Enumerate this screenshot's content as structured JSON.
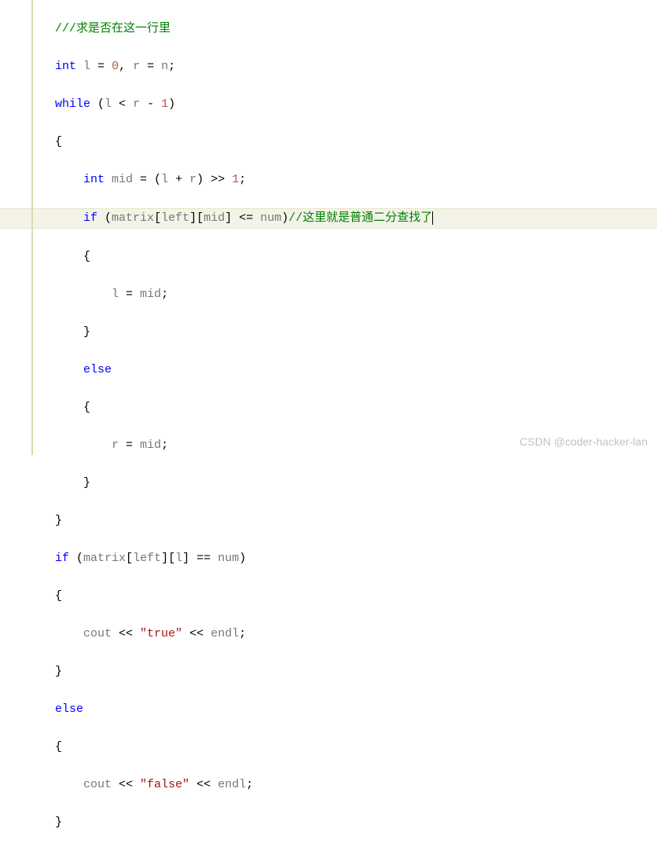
{
  "lines": {
    "l0_comment": "///求是否在这一行里",
    "l1_type": "int",
    "l1_var1": "l",
    "l1_eq1": " = ",
    "l1_val1": "0",
    "l1_comma": ", ",
    "l1_var2": "r",
    "l1_eq2": " = ",
    "l1_val2": "n",
    "l1_semi": ";",
    "l2_kw": "while",
    "l2_open": " (",
    "l2_a": "l",
    "l2_lt": " < ",
    "l2_b": "r",
    "l2_minus": " - ",
    "l2_c": "1",
    "l2_close": ")",
    "l3_brace": "{",
    "l4_type": "int",
    "l4_var": " mid",
    "l4_eq": " = (",
    "l4_a": "l",
    "l4_plus": " + ",
    "l4_b": "r",
    "l4_close": ") >> ",
    "l4_c": "1",
    "l4_semi": ";",
    "l5_kw": "if",
    "l5_open": " (",
    "l5_a": "matrix",
    "l5_b1o": "[",
    "l5_b": "left",
    "l5_b1c": "][",
    "l5_c": "mid",
    "l5_b2c": "] <= ",
    "l5_d": "num",
    "l5_close": ")",
    "l5_comment": "//这里就是普通二分查找了",
    "l6_brace": "{",
    "l7_a": "l",
    "l7_eq": " = ",
    "l7_b": "mid",
    "l7_semi": ";",
    "l8_brace": "}",
    "l9_kw": "else",
    "l10_brace": "{",
    "l11_a": "r",
    "l11_eq": " = ",
    "l11_b": "mid",
    "l11_semi": ";",
    "l12_brace": "}",
    "l13_brace": "}",
    "l14_kw": "if",
    "l14_open": " (",
    "l14_a": "matrix",
    "l14_b1o": "[",
    "l14_b": "left",
    "l14_b1c": "][",
    "l14_c": "l",
    "l14_b2c": "] == ",
    "l14_d": "num",
    "l14_close": ")",
    "l15_brace": "{",
    "l16_a": "cout",
    "l16_op1": " << ",
    "l16_s": "\"true\"",
    "l16_op2": " << ",
    "l16_b": "endl",
    "l16_semi": ";",
    "l17_brace": "}",
    "l18_kw": "else",
    "l19_brace": "{",
    "l20_a": "cout",
    "l20_op1": " << ",
    "l20_s": "\"false\"",
    "l20_op2": " << ",
    "l20_b": "endl",
    "l20_semi": ";",
    "l21_brace": "}"
  },
  "watermark": "CSDN @coder-hacker-lan"
}
